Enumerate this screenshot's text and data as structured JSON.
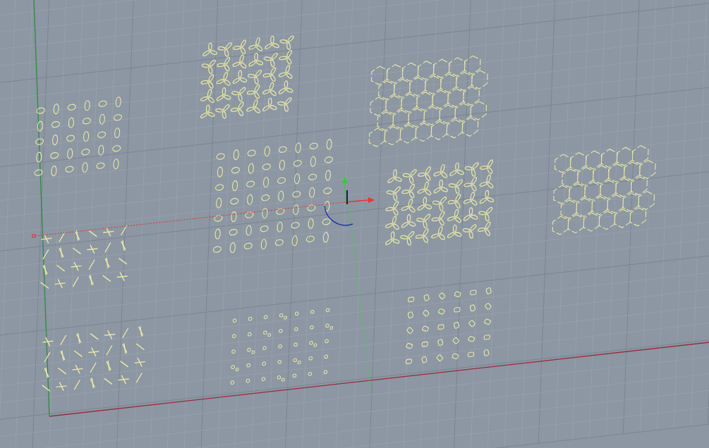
{
  "patterns": [
    {
      "kind": "ellipses"
    },
    {
      "kind": "trefoils"
    },
    {
      "kind": "hexagons"
    },
    {
      "kind": "dashes"
    },
    {
      "kind": "ellipses"
    },
    {
      "kind": "trefoils"
    },
    {
      "kind": "hexagons"
    },
    {
      "kind": "dashes"
    },
    {
      "kind": "dots"
    },
    {
      "kind": "tiles"
    }
  ]
}
